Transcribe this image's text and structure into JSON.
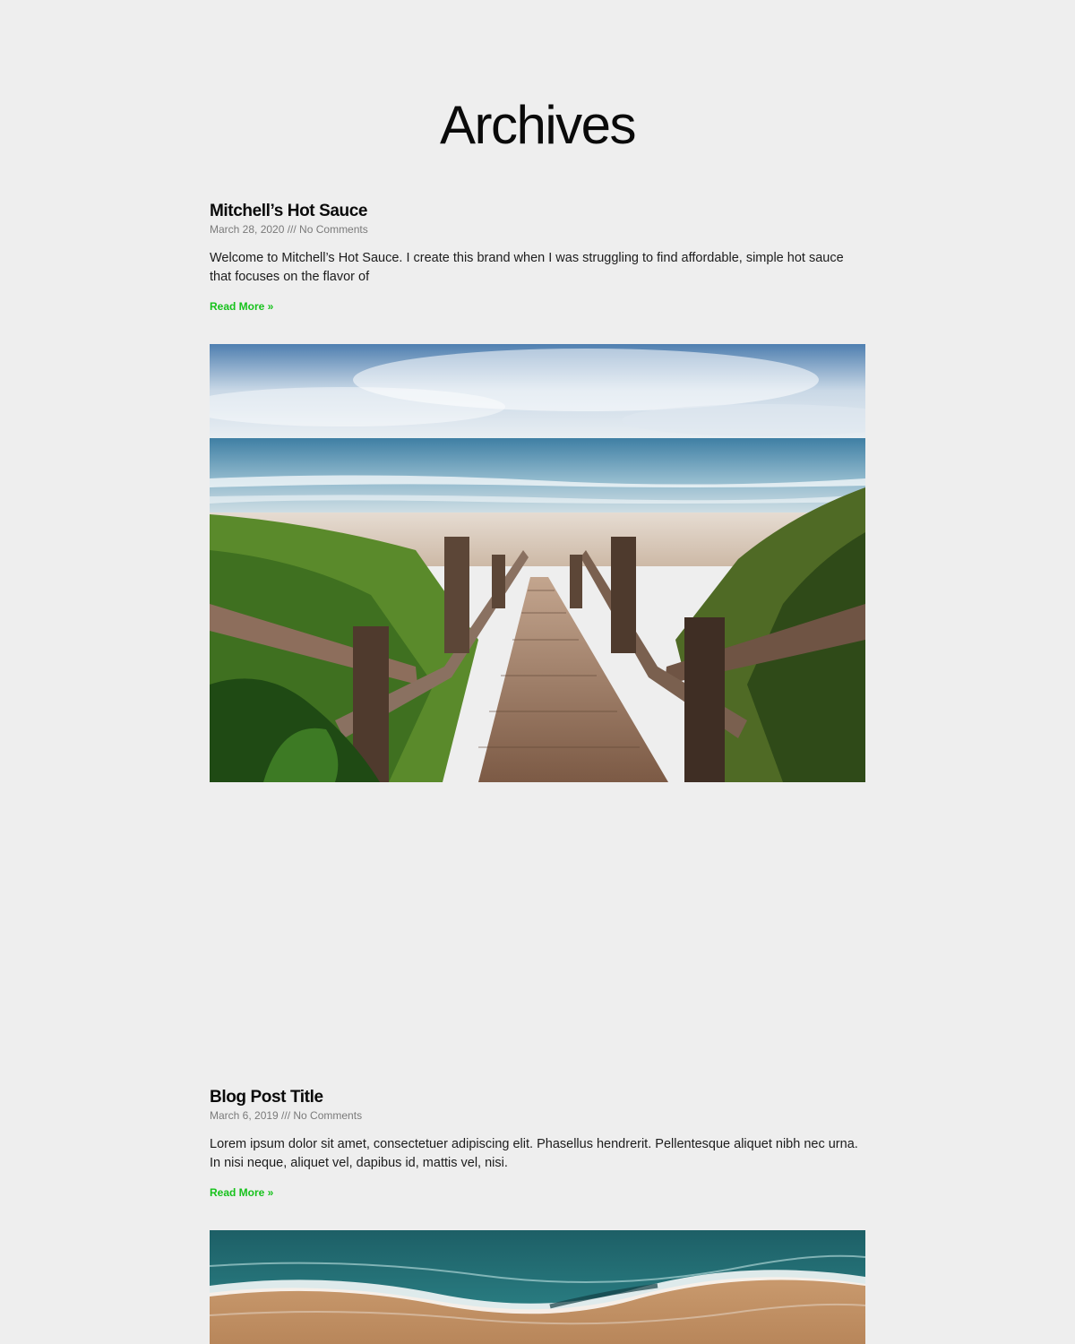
{
  "page": {
    "title": "Archives",
    "background": "#eeeeee",
    "accent": "#17c21c"
  },
  "posts": [
    {
      "title": "Mitchell’s Hot Sauce",
      "meta": "March 28, 2020 /// No Comments",
      "excerpt": "Welcome to Mitchell’s Hot Sauce. I create this brand when I was struggling to find affordable, simple hot sauce that focuses on the flavor of",
      "read_more": "Read More »",
      "image": "beach-boardwalk-stairs-photo"
    },
    {
      "title": "Blog Post Title",
      "meta": "March 6, 2019 /// No Comments",
      "excerpt": "Lorem ipsum dolor sit amet, consectetuer adipiscing elit. Phasellus hendrerit. Pellentesque aliquet nibh nec urna. In nisi neque, aliquet vel, dapibus id, mattis vel, nisi.",
      "read_more": "Read More »",
      "image": "aerial-beach-waves-photo"
    }
  ]
}
